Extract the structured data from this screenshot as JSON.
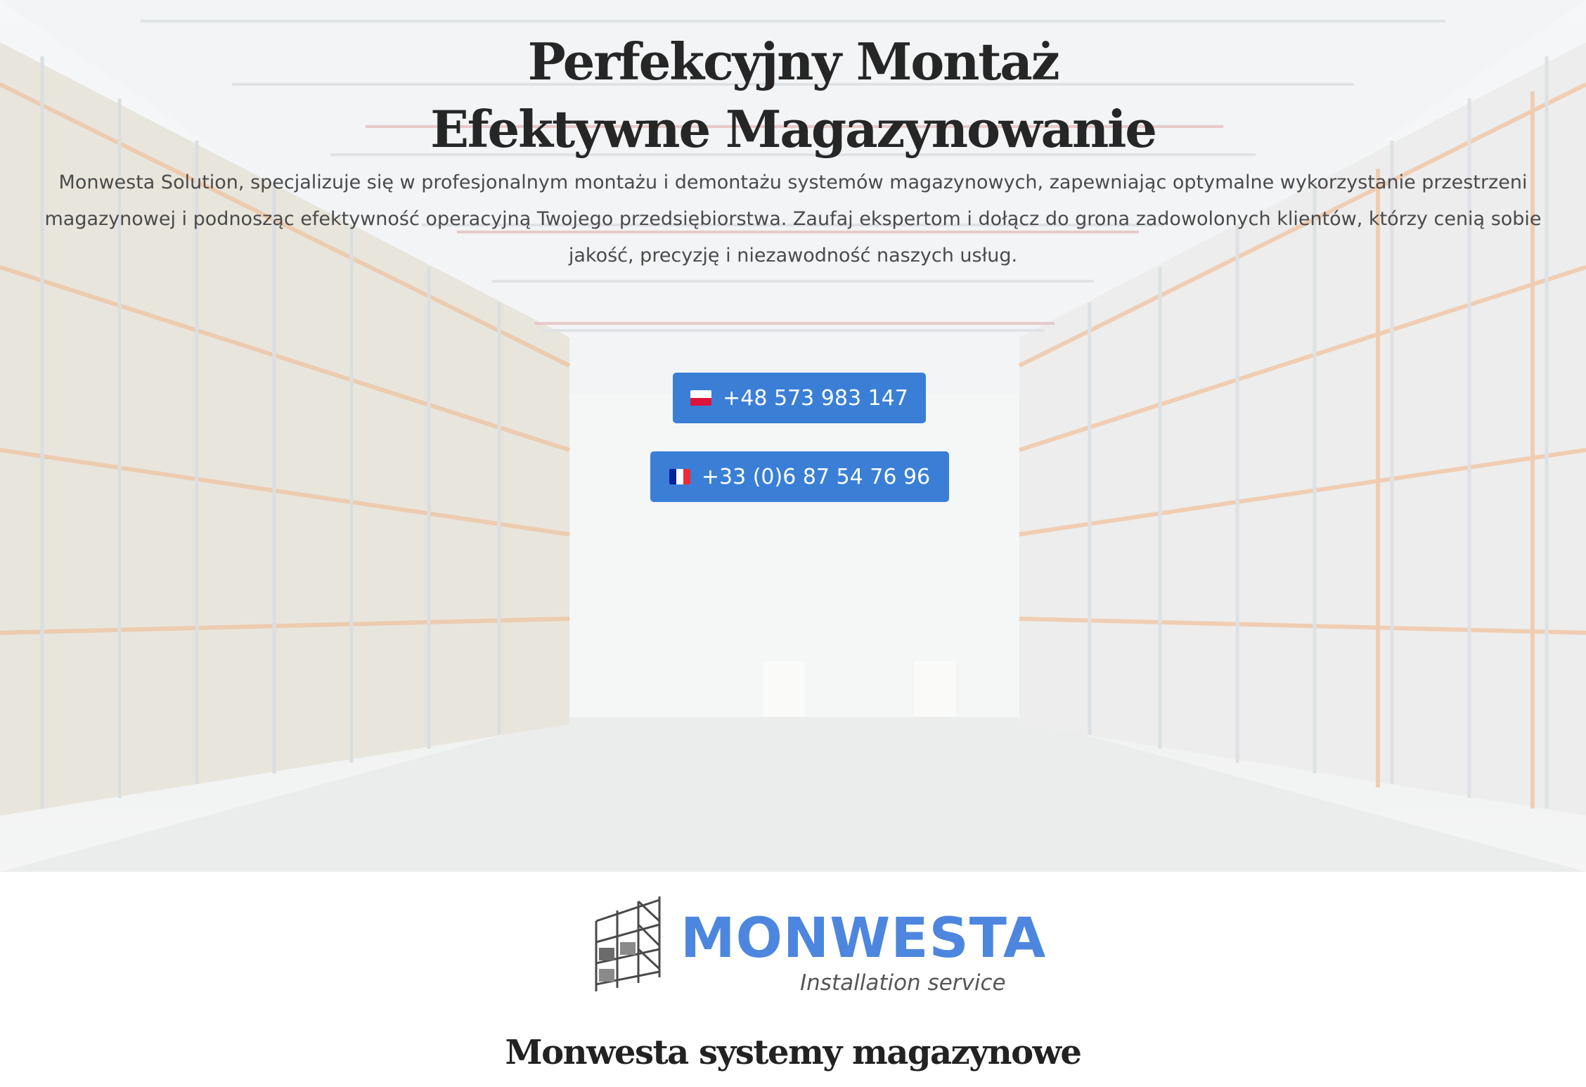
{
  "hero": {
    "title_line1": "Perfekcyjny Montaż",
    "title_line2": "Efektywne Magazynowanie",
    "description": "Monwesta Solution, specjalizuje się w profesjonalnym montażu i demontażu systemów magazynowych, zapewniając optymalne wykorzystanie przestrzeni magazynowej i podnosząc efektywność operacyjną Twojego przedsiębiorstwa. Zaufaj ekspertom i dołącz do grona zadowolonych klientów, którzy cenią sobie jakość, precyzję i niezawodność naszych usług.",
    "background": "warehouse-photo"
  },
  "phones": [
    {
      "flag": "poland-flag-icon",
      "label": "+48 573 983 147"
    },
    {
      "flag": "france-flag-icon",
      "label": "+33 (0)6 87 54 76 96"
    }
  ],
  "logo": {
    "wordmark": "MONWESTA",
    "tagline": "Installation service",
    "icon": "storage-rack-icon",
    "color": "#4d86de"
  },
  "section": {
    "title": "Monwesta systemy magazynowe"
  },
  "colors": {
    "button": "#3a7fd5",
    "heading": "#262626"
  }
}
